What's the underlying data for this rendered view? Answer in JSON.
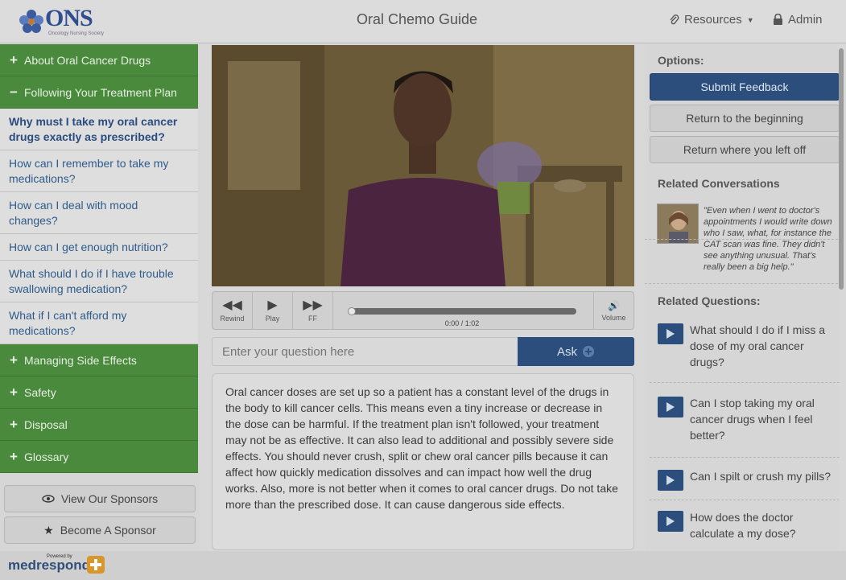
{
  "header": {
    "logo": "ONS",
    "logo_subtitle": "Oncology Nursing Society",
    "title": "Oral Chemo Guide",
    "resources_label": "Resources",
    "admin_label": "Admin"
  },
  "sidebar": {
    "categories": [
      {
        "label": "About Oral Cancer Drugs",
        "expanded": false
      },
      {
        "label": "Following Your Treatment Plan",
        "expanded": true
      },
      {
        "label": "Managing Side Effects",
        "expanded": false
      },
      {
        "label": "Safety",
        "expanded": false
      },
      {
        "label": "Disposal",
        "expanded": false
      },
      {
        "label": "Glossary",
        "expanded": false
      }
    ],
    "items": [
      "Why must I take my oral cancer drugs exactly as prescribed?",
      "How can I remember to take my medications?",
      "How can I deal with mood changes?",
      "How can I get enough nutrition?",
      "What should I do if I have trouble swallowing medication?",
      "What if I can't afford my medications?"
    ],
    "sponsors_label": "View Our Sponsors",
    "become_sponsor_label": "Become A Sponsor"
  },
  "player": {
    "rewind": "Rewind",
    "play": "Play",
    "ff": "FF",
    "volume": "Volume",
    "time": "0:00 / 1:02",
    "progress": 0
  },
  "ask": {
    "placeholder": "Enter your question here",
    "button": "Ask"
  },
  "answer": "Oral cancer doses are set up so a patient has a constant level of the drugs in the body to kill cancer cells. This means even a tiny increase or decrease in the dose can be harmful. If the treatment plan isn't followed, your treatment may not be as effective. It can also lead to additional and possibly severe side effects. You should never crush, split or chew oral cancer pills because it can affect how quickly medication dissolves and can impact how well the drug works. Also, more is not better when it comes to oral cancer drugs. Do not take more than the prescribed dose. It can cause dangerous side effects.",
  "options": {
    "heading": "Options:",
    "submit_feedback": "Submit Feedback",
    "return_beginning": "Return to the beginning",
    "return_left_off": "Return where you left off"
  },
  "related_conversations": {
    "heading": "Related Conversations",
    "quote": "\"Even when I went to doctor's appointments I would write down who I saw, what, for instance the CAT scan was fine. They didn't see anything unusual. That's really been a big help.\""
  },
  "related_questions": {
    "heading": "Related Questions:",
    "items": [
      "What should I do if I miss a dose of my oral cancer drugs?",
      "Can I stop taking my oral cancer drugs when I feel better?",
      "Can I spilt or crush my pills?",
      "How does the doctor calculate a my dose?"
    ]
  },
  "footer": {
    "powered_by": "Powered by",
    "brand": "medrespond"
  },
  "colors": {
    "green": "#4a8a3c",
    "navy": "#2c4e7c",
    "link": "#2e5b8a"
  }
}
